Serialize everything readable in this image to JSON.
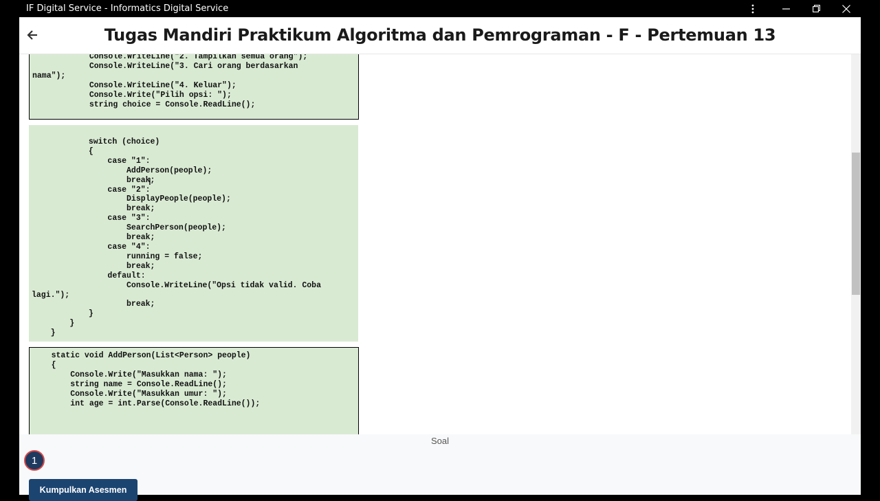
{
  "window": {
    "title": "IF Digital Service - Informatics Digital Service",
    "controls": [
      "more-options",
      "minimize",
      "restore",
      "close"
    ]
  },
  "header": {
    "page_title": "Tugas Mandiri Praktikum Algoritma dan Pemrograman - F - Pertemuan 13",
    "back_icon": "arrow-left-icon"
  },
  "code_blocks": [
    "            Console.WriteLine(\"2. Tampilkan semua orang\");\n            Console.WriteLine(\"3. Cari orang berdasarkan\nnama\");\n            Console.WriteLine(\"4. Keluar\");\n            Console.Write(\"Pilih opsi: \");\n            string choice = Console.ReadLine();",
    "            switch (choice)\n            {\n                case \"1\":\n                    AddPerson(people);\n                    break;\n                case \"2\":\n                    DisplayPeople(people);\n                    break;\n                case \"3\":\n                    SearchPerson(people);\n                    break;\n                case \"4\":\n                    running = false;\n                    break;\n                default:\n                    Console.WriteLine(\"Opsi tidak valid. Coba\nlagi.\");\n                    break;\n            }\n        }\n    }",
    "    static void AddPerson(List<Person> people)\n    {\n        Console.Write(\"Masukkan nama: \");\n        string name = Console.ReadLine();\n        Console.Write(\"Masukkan umur: \");\n        int age = int.Parse(Console.ReadLine());"
  ],
  "footer": {
    "section_label": "Soal",
    "question_numbers": [
      "1"
    ],
    "submit_label": "Kumpulkan Asesmen"
  },
  "colors": {
    "code_background": "#d9ead3",
    "submit_button": "#1c4470",
    "question_badge": "#1f3a5f",
    "question_badge_border": "#d84a4a"
  }
}
